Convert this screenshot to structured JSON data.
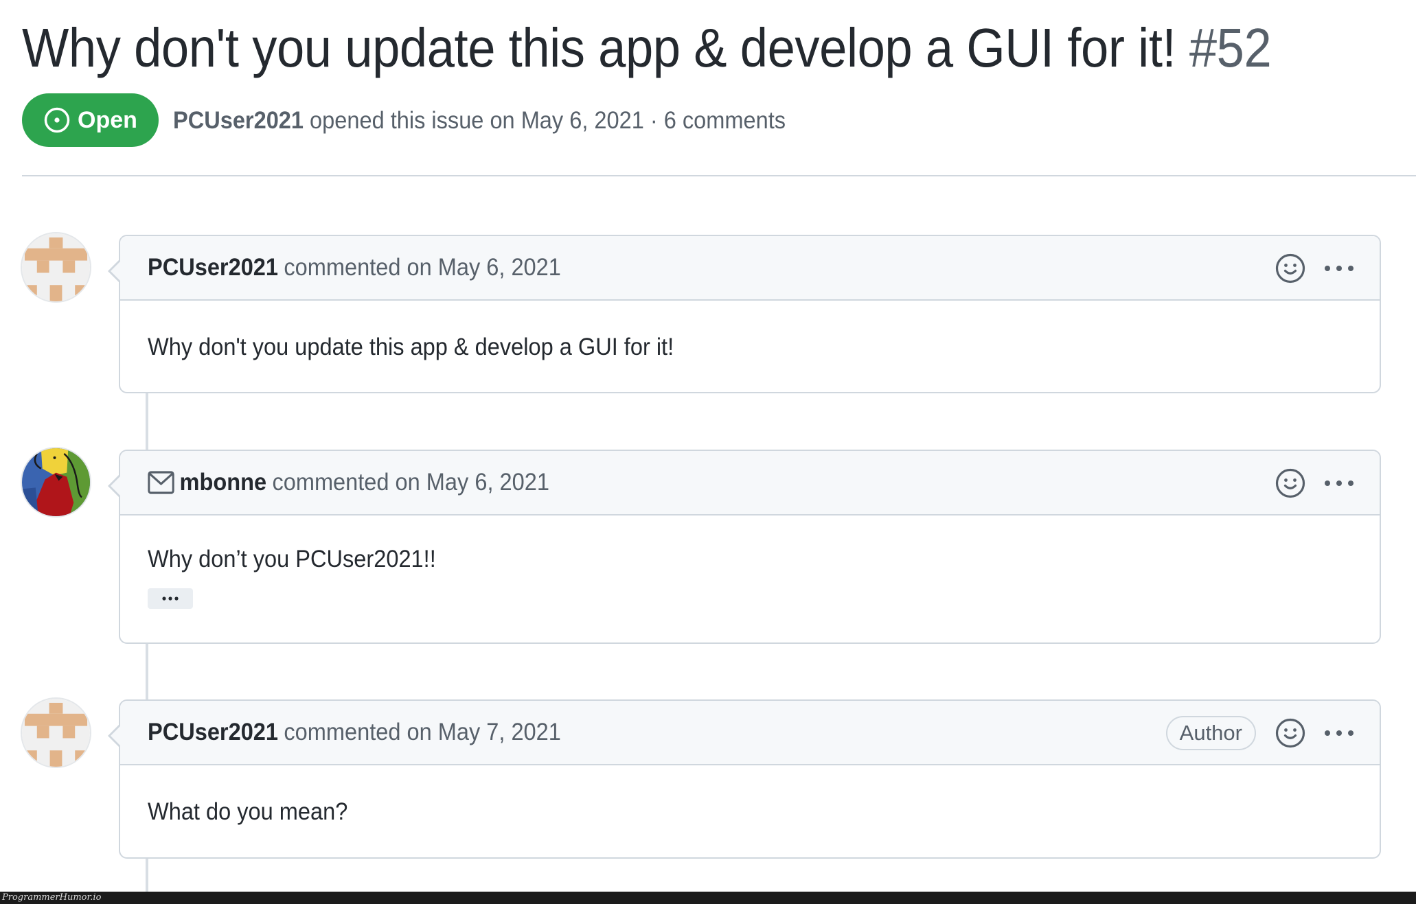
{
  "issue": {
    "title": "Why don't you update this app & develop a GUI for it!",
    "number": "#52",
    "state": {
      "label": "Open",
      "icon": "issue-opened-icon",
      "color": "#2da44e"
    },
    "meta": {
      "author": "PCUser2021",
      "text": " opened this issue on May 6, 2021 · 6 comments"
    }
  },
  "comments": [
    {
      "author": "PCUser2021",
      "action": "commented on May 6, 2021",
      "avatar": "identicon-avatar",
      "badge": null,
      "via_email": false,
      "body": "Why don't you update this app & develop a GUI for it!",
      "has_hidden_content": false
    },
    {
      "author": "mbonne",
      "action": "commented on May 6, 2021",
      "avatar": "painting-avatar",
      "badge": null,
      "via_email": true,
      "body": "Why don’t you PCUser2021!!",
      "has_hidden_content": true,
      "hidden_content_label": "•••"
    },
    {
      "author": "PCUser2021",
      "action": "commented on May 7, 2021",
      "avatar": "identicon-avatar",
      "badge": "Author",
      "via_email": false,
      "body": "What do you mean?",
      "has_hidden_content": false
    }
  ],
  "watermark": "ProgrammerHumor.io"
}
